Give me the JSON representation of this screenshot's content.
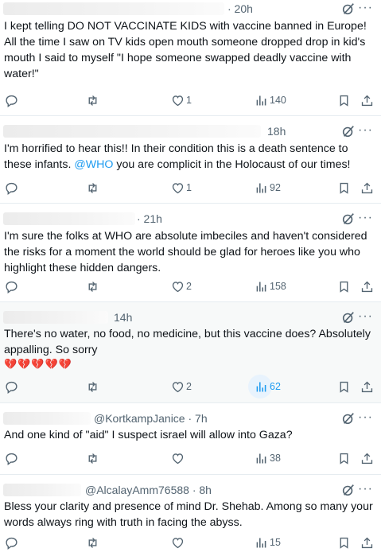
{
  "posts": [
    {
      "name": "",
      "handle": "",
      "time": "· 20h",
      "text": "I kept telling DO NOT VACCINATE KIDS with vaccine banned in Europe! All the time I saw on TV kids open mouth someone dropped drop in kid's mouth I said to myself \"I hope someone swapped deadly vaccine with water!\"",
      "replies": "",
      "reposts": "",
      "likes": "1",
      "views": "140"
    },
    {
      "name": "",
      "handle": "",
      "time": "18h",
      "text_before": "I'm horrified to hear this!! In their condition this is a death sentence to these infants. ",
      "mention": "@WHO",
      "text_after": " you are complicit in the Holocaust of our times!",
      "replies": "",
      "reposts": "",
      "likes": "1",
      "views": "92"
    },
    {
      "name": "",
      "handle": "",
      "time": "· 21h",
      "text": "I'm sure the folks at WHO are absolute imbeciles and haven't considered the risks for a moment the world should be glad for heroes like you who highlight these hidden dangers.",
      "replies": "",
      "reposts": "",
      "likes": "2",
      "views": "158"
    },
    {
      "name": "",
      "handle": "",
      "time": "14h",
      "text": "There's no water, no food, no medicine, but this vaccine does? Absolutely appalling. So sorry",
      "emoji": "💔💔💔💔💔",
      "replies": "",
      "reposts": "",
      "likes": "2",
      "views": "62"
    },
    {
      "name": "",
      "handle": "@KortkampJanice",
      "time": "· 7h",
      "text": "And one kind of \"aid\" I suspect israel will allow into Gaza?",
      "replies": "",
      "reposts": "",
      "likes": "",
      "views": "38"
    },
    {
      "name": "",
      "handle": "@AlcalayAmm76588",
      "time": "· 8h",
      "text": "Bless your clarity and presence of mind Dr. Shehab. Among so many your words always ring with truth in facing the abyss.",
      "replies": "",
      "reposts": "",
      "likes": "",
      "views": "15"
    }
  ],
  "more_glyph": "···",
  "colors": {
    "accent": "#1d9bf0",
    "muted": "#536471",
    "text": "#0f1419",
    "emoji_red": "#e0245e"
  },
  "icons": [
    "reply-icon",
    "repost-icon",
    "like-icon",
    "views-icon",
    "bookmark-icon",
    "share-icon",
    "grok-icon",
    "more-icon"
  ]
}
